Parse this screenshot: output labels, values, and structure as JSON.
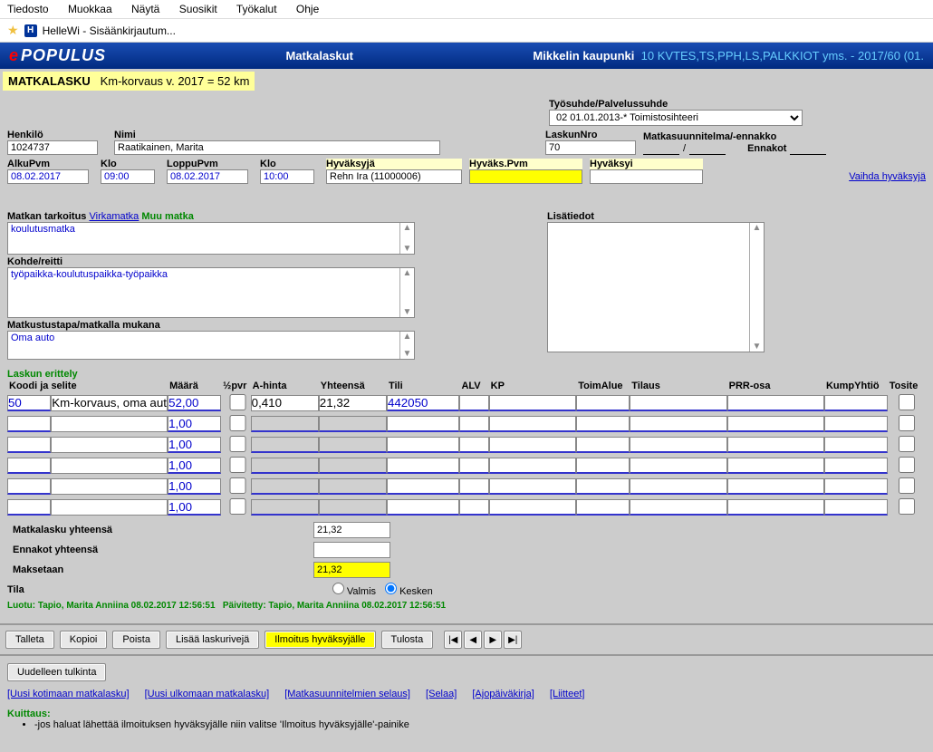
{
  "menubar": [
    "Tiedosto",
    "Muokkaa",
    "Näytä",
    "Suosikit",
    "Työkalut",
    "Ohje"
  ],
  "bookmark": "HelleWi - Sisäänkirjautum...",
  "header": {
    "logo_prefix": "e",
    "logo_text": "POPULUS",
    "title": "Matkalaskut",
    "org": "Mikkelin kaupunki",
    "context": "10 KVTES,TS,PPH,LS,PALKKIOT yms. - 2017/60 (01."
  },
  "subheader": {
    "label": "MATKALASKU",
    "rate": "Km-korvaus v. 2017 = 52 km"
  },
  "tyosuhde": {
    "label": "Työsuhde/Palvelussuhde",
    "value": "02 01.01.2013-* Toimistosihteeri"
  },
  "henkilo": {
    "label": "Henkilö",
    "value": "1024737"
  },
  "nimi": {
    "label": "Nimi",
    "value": "Raatikainen, Marita"
  },
  "laskunro": {
    "label": "LaskunNro",
    "value": "70"
  },
  "matkasuunn": {
    "label": "Matkasuunnitelma/-ennakko",
    "ennakot": "Ennakot"
  },
  "dates": {
    "alkupvm": {
      "label": "AlkuPvm",
      "value": "08.02.2017"
    },
    "klo1": {
      "label": "Klo",
      "value": "09:00"
    },
    "loppupvm": {
      "label": "LoppuPvm",
      "value": "08.02.2017"
    },
    "klo2": {
      "label": "Klo",
      "value": "10:00"
    }
  },
  "hyvaksyja": {
    "label": "Hyväksyjä",
    "value": "Rehn Ira (11000006)"
  },
  "hyvaks_pvm": {
    "label": "Hyväks.Pvm",
    "value": ""
  },
  "hyvaksyi": {
    "label": "Hyväksyi",
    "value": ""
  },
  "vaihda_link": "Vaihda hyväksyjä",
  "tarkoitus": {
    "label": "Matkan tarkoitus",
    "virka": "Virkamatka",
    "muu": "Muu matka",
    "value": "koulutusmatka"
  },
  "lisatiedot": {
    "label": "Lisätiedot",
    "value": ""
  },
  "kohde": {
    "label": "Kohde/reitti",
    "value": "työpaikka-koulutuspaikka-työpaikka"
  },
  "matkustustapa": {
    "label": "Matkustustapa/matkalla mukana",
    "value": "Oma auto"
  },
  "erittely_title": "Laskun erittely",
  "grid": {
    "headers": [
      "Koodi ja selite",
      "Määrä",
      "½pvr",
      "A-hinta",
      "Yhteensä",
      "Tili",
      "ALV",
      "KP",
      "ToimAlue",
      "Tilaus",
      "PRR-osa",
      "KumpYhtiö",
      "Tosite"
    ],
    "rows": [
      {
        "koodi": "50",
        "selite": "Km-korvaus, oma auto",
        "maara": "52,00",
        "ahinta": "0,410",
        "yht": "21,32",
        "tili": "442050"
      },
      {
        "maara": "1,00"
      },
      {
        "maara": "1,00"
      },
      {
        "maara": "1,00"
      },
      {
        "maara": "1,00"
      },
      {
        "maara": "1,00"
      }
    ]
  },
  "totals": {
    "matkalasku": {
      "label": "Matkalasku yhteensä",
      "value": "21,32"
    },
    "ennakot": {
      "label": "Ennakot yhteensä",
      "value": ""
    },
    "maksetaan": {
      "label": "Maksetaan",
      "value": "21,32"
    }
  },
  "tila": {
    "label": "Tila",
    "valmis": "Valmis",
    "kesken": "Kesken"
  },
  "audit": {
    "luotu": "Luotu: Tapio, Marita Anniina 08.02.2017 12:56:51",
    "paiv": "Päivitetty: Tapio, Marita Anniina 08.02.2017 12:56:51"
  },
  "buttons": {
    "talleta": "Talleta",
    "kopioi": "Kopioi",
    "poista": "Poista",
    "lisaa": "Lisää laskurivejä",
    "ilmoitus": "Ilmoitus hyväksyjälle",
    "tulosta": "Tulosta",
    "uudelleen": "Uudelleen tulkinta"
  },
  "bottom_links": [
    "[Uusi kotimaan matkalasku]",
    "[Uusi ulkomaan matkalasku]",
    "[Matkasuunnitelmien selaus]",
    "[Selaa]",
    "[Ajopäiväkirja]",
    "[Liitteet]"
  ],
  "kuittaus": {
    "title": "Kuittaus:",
    "text": "-jos haluat lähettää ilmoituksen hyväksyjälle niin valitse 'Ilmoitus hyväksyjälle'-painike"
  }
}
